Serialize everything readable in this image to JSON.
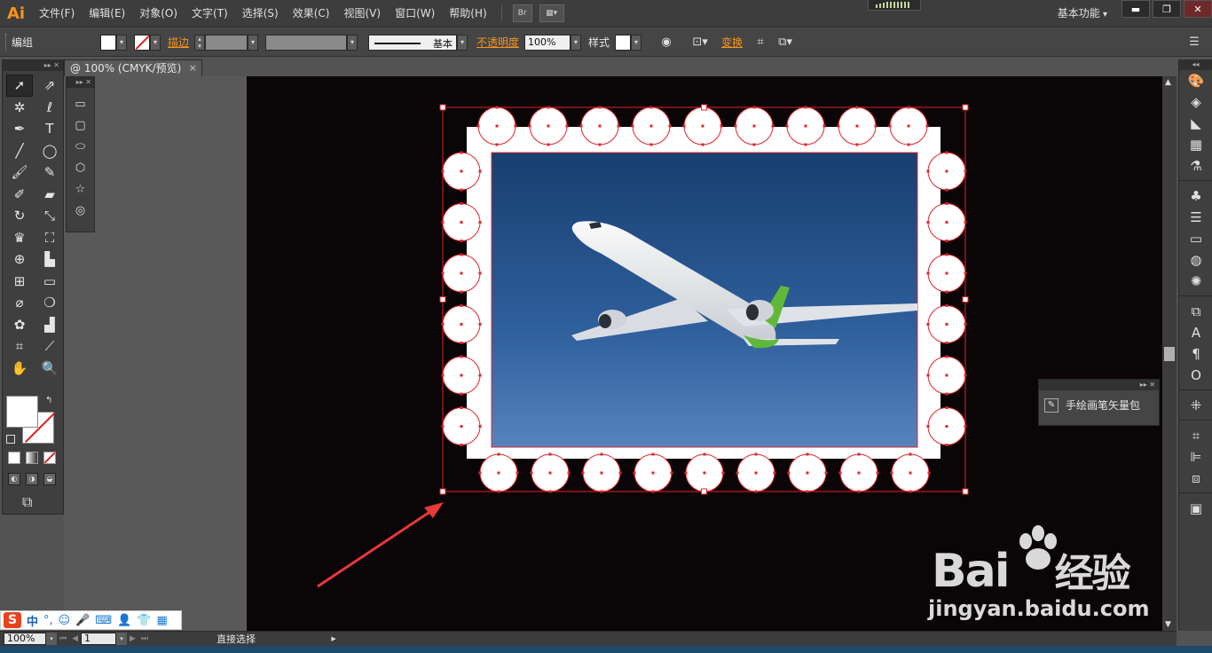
{
  "app": {
    "logo": "Ai",
    "menus": [
      "文件(F)",
      "编辑(E)",
      "对象(O)",
      "文字(T)",
      "选择(S)",
      "效果(C)",
      "视图(V)",
      "窗口(W)",
      "帮助(H)"
    ],
    "bridge_label": "Br",
    "workspace": "基本功能"
  },
  "control_bar": {
    "selection_type": "编组",
    "stroke_label": "描边",
    "stroke_profile": "基本",
    "opacity_label": "不透明度",
    "opacity_value": "100%",
    "style_label": "样式",
    "transform_label": "变换"
  },
  "document": {
    "tab_title": "@ 100% (CMYK/预览)",
    "tab_close": "×"
  },
  "status_bar": {
    "zoom": "100%",
    "artboard_number": "1",
    "current_tool": "直接选择"
  },
  "brush_panel": {
    "item_label": "手绘画笔矢量包"
  },
  "ime": {
    "logo": "S",
    "mode": "中"
  },
  "watermark": {
    "brand": "Bai",
    "brand_suffix": "经验",
    "url": "jingyan.baidu.com"
  },
  "colors": {
    "selection_red": "#e0242c",
    "accent_orange": "#f7941d",
    "sky_top": "#1a4a80",
    "sky_bottom": "#4a7cb8",
    "stamp_white": "#ffffff",
    "annotation_arrow": "#e8383a"
  }
}
